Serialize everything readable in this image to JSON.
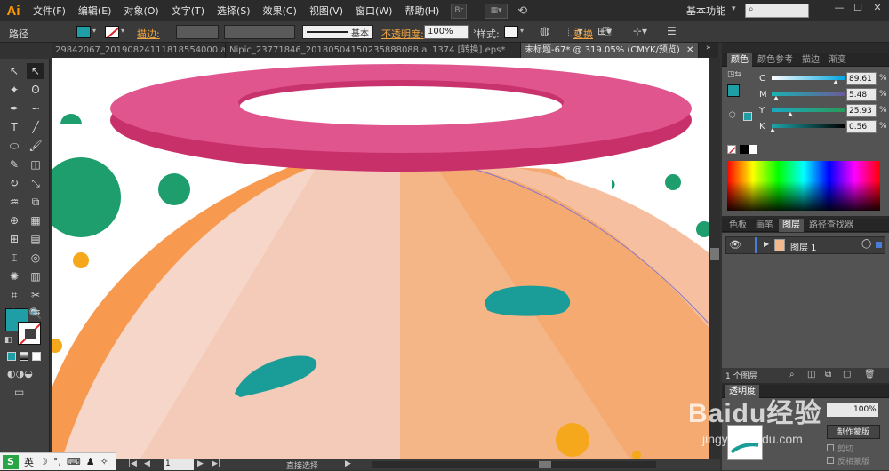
{
  "app": {
    "logo": "Ai",
    "workspace": "基本功能"
  },
  "menus": [
    "文件(F)",
    "编辑(E)",
    "对象(O)",
    "文字(T)",
    "选择(S)",
    "效果(C)",
    "视图(V)",
    "窗口(W)",
    "帮助(H)"
  ],
  "menu_extra": {
    "bridge": "Br",
    "stock": "St"
  },
  "control": {
    "selection_label": "路径",
    "stroke_label": "描边:",
    "stroke_style": "基本",
    "opacity_label": "不透明度:",
    "opacity_value": "100%",
    "style_label": "样式:",
    "transform_label": "变换",
    "fill_color": "#1f9ea5"
  },
  "tabs": [
    {
      "label": "29842067_20190824111818554000.ai*"
    },
    {
      "label": "Nipic_23771846_20180504150235888088.ai*"
    },
    {
      "label": "1374 [转换].eps*"
    },
    {
      "label": "未标题-67* @ 319.05% (CMYK/预览)"
    }
  ],
  "color_panel": {
    "tabs": [
      "颜色",
      "颜色参考",
      "描边",
      "渐变"
    ],
    "channels": [
      {
        "key": "C",
        "value": "89.61",
        "unit": "%",
        "fraction": 0.8961
      },
      {
        "key": "M",
        "value": "5.48",
        "unit": "%",
        "fraction": 0.0548
      },
      {
        "key": "Y",
        "value": "25.93",
        "unit": "%",
        "fraction": 0.2593
      },
      {
        "key": "K",
        "value": "0.56",
        "unit": "%",
        "fraction": 0.0056
      }
    ]
  },
  "layers_panel": {
    "tabs": [
      "色板",
      "画笔",
      "图层",
      "路径查找器"
    ],
    "layer_name": "图层 1",
    "count_label": "1 个图层"
  },
  "transparency_panel": {
    "tabs": [
      "透明度"
    ],
    "opacity_value": "100%",
    "make_mask": "制作蒙版",
    "clip": "剪切",
    "invert": "反相蒙版"
  },
  "status": {
    "zoom": "319.05",
    "page": "1",
    "tool": "直接选择"
  },
  "watermark": {
    "brand": "Baidu经验",
    "url": "jingyan.baidu.com"
  },
  "ime": {
    "label": "英"
  },
  "colors": {
    "pink_ring": "#e0508a",
    "pink_ring_dark": "#c8306a",
    "orange": "#f79a50",
    "peach": "#f6b38a",
    "light_peach": "#f6d2c4",
    "green": "#1e9e6c",
    "teal": "#1a9d98",
    "yellow": "#f5a81b"
  }
}
